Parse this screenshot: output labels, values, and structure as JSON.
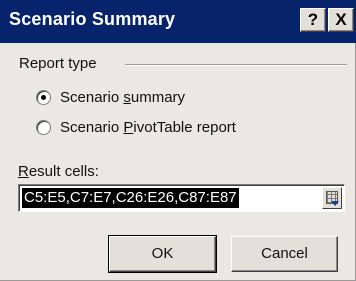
{
  "window": {
    "title": "Scenario Summary",
    "help_glyph": "?",
    "close_glyph": "X"
  },
  "report_type": {
    "group_label": "Report type",
    "options": [
      {
        "pre": "Scenario ",
        "accel": "s",
        "post": "ummary",
        "selected": true
      },
      {
        "pre": "Scenario ",
        "accel": "P",
        "post": "ivotTable report",
        "selected": false
      }
    ]
  },
  "result_cells": {
    "label_accel": "R",
    "label_rest": "esult cells:",
    "value": "C5:E5,C7:E7,C26:E26,C87:E87",
    "collapse_icon": "collapse-dialog-icon"
  },
  "buttons": {
    "ok_label": "OK",
    "cancel_label": "Cancel"
  },
  "colors": {
    "titlebar": "#06236b",
    "dialog_face": "#ebe8e3"
  }
}
